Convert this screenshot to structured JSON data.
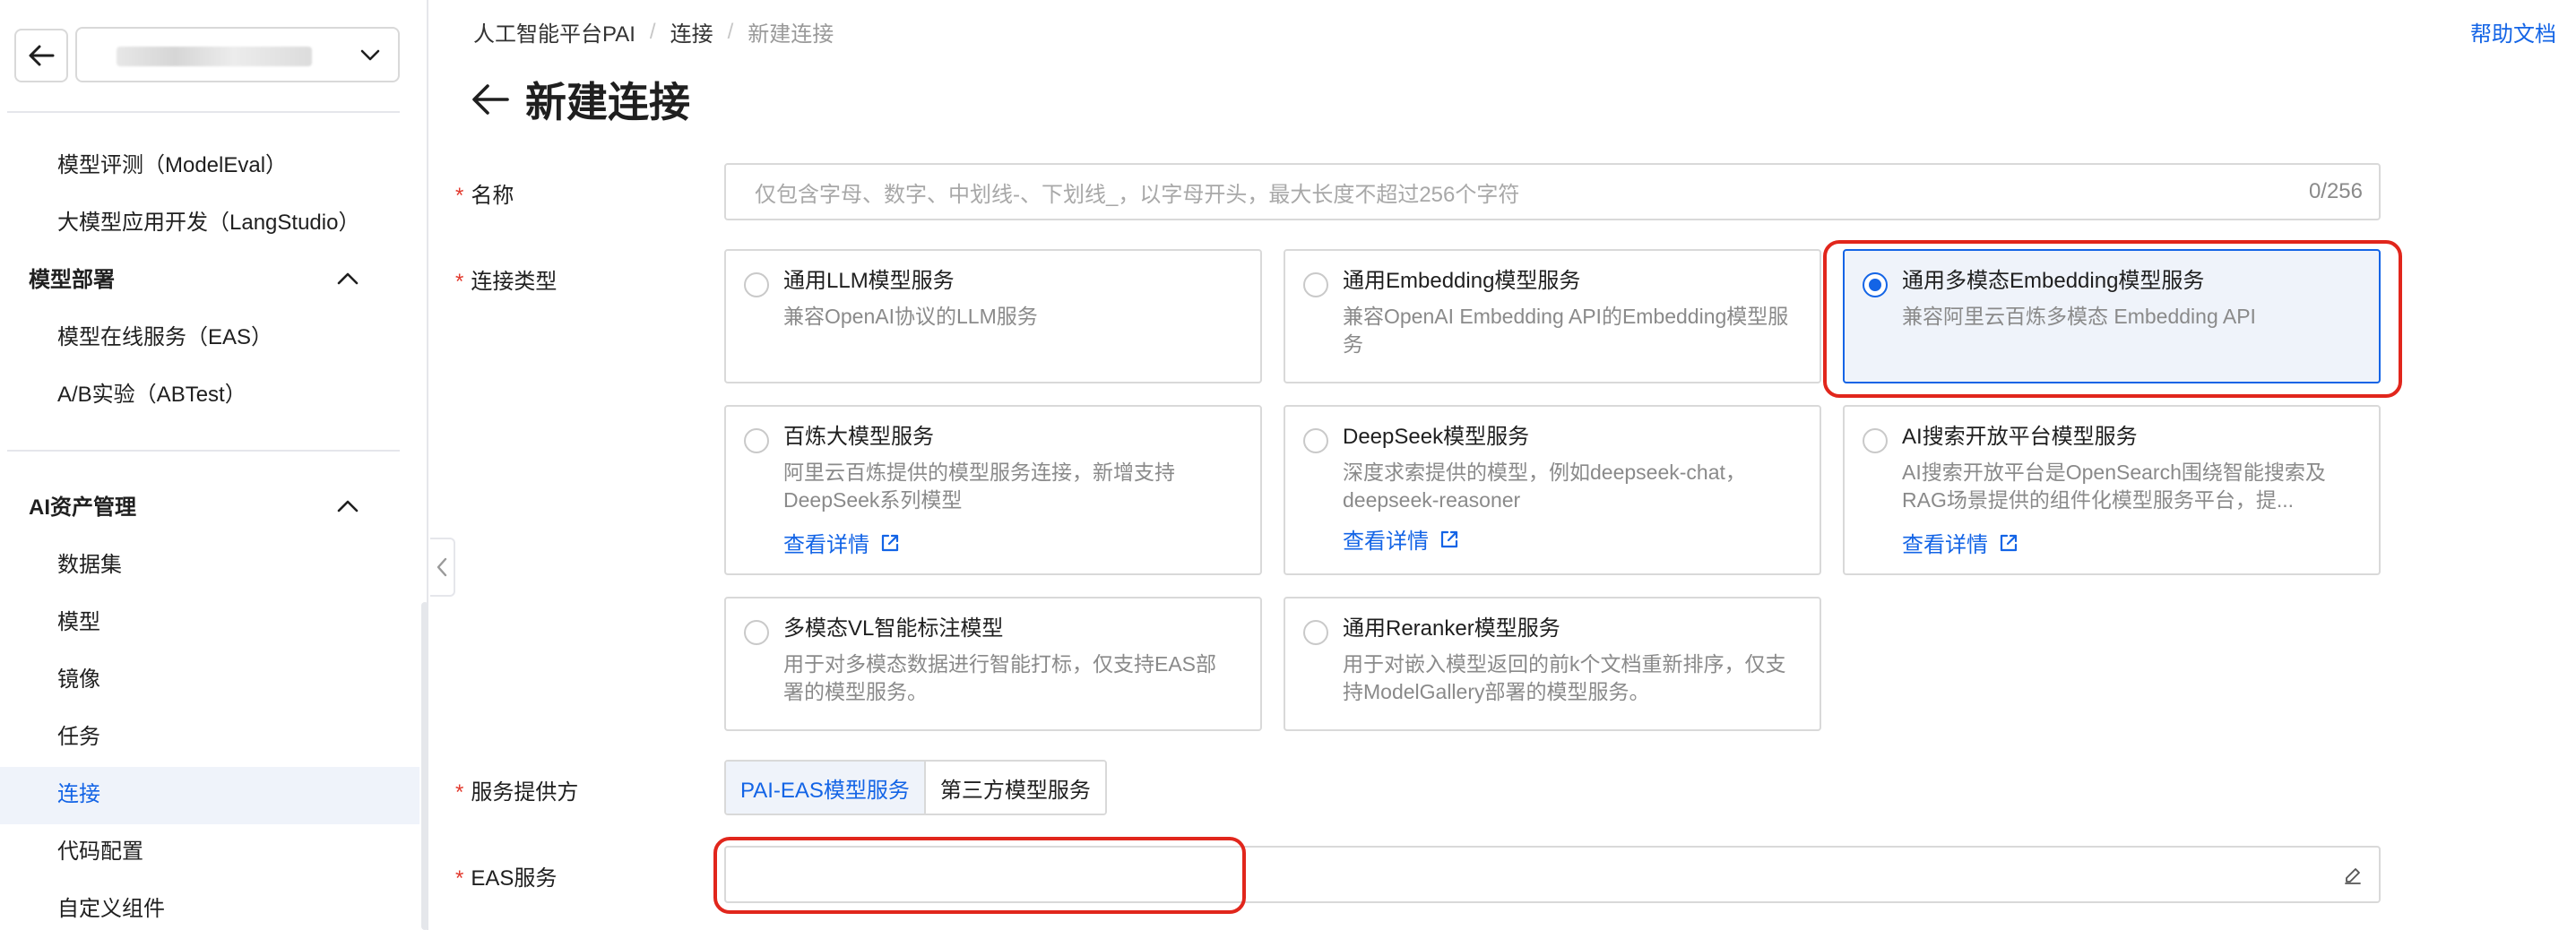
{
  "sidebar": {
    "workspace_value": "",
    "items_top": [
      {
        "label": "模型评测（ModelEval）"
      },
      {
        "label": "大模型应用开发（LangStudio）"
      }
    ],
    "group_deploy": {
      "label": "模型部署"
    },
    "items_deploy": [
      {
        "label": "模型在线服务（EAS）"
      },
      {
        "label": "A/B实验（ABTest）"
      }
    ],
    "group_assets": {
      "label": "AI资产管理"
    },
    "items_assets": [
      {
        "label": "数据集"
      },
      {
        "label": "模型"
      },
      {
        "label": "镜像"
      },
      {
        "label": "任务"
      },
      {
        "label": "连接",
        "active": true
      },
      {
        "label": "代码配置"
      },
      {
        "label": "自定义组件"
      }
    ]
  },
  "breadcrumb": [
    "人工智能平台PAI",
    "连接",
    "新建连接"
  ],
  "help_link": "帮助文档",
  "page_title": "新建连接",
  "form": {
    "name": {
      "label": "名称",
      "placeholder": "仅包含字母、数字、中划线-、下划线_，以字母开头，最大长度不超过256个字符",
      "count": "0/256"
    },
    "type": {
      "label": "连接类型",
      "selected": "通用多模态Embedding模型服务",
      "cards": [
        {
          "title": "通用LLM模型服务",
          "desc": "兼容OpenAI协议的LLM服务"
        },
        {
          "title": "通用Embedding模型服务",
          "desc": "兼容OpenAI Embedding API的Embedding模型服务"
        },
        {
          "title": "通用多模态Embedding模型服务",
          "desc": "兼容阿里云百炼多模态 Embedding API"
        },
        {
          "title": "百炼大模型服务",
          "desc": "阿里云百炼提供的模型服务连接，新增支持DeepSeek系列模型",
          "link": "查看详情"
        },
        {
          "title": "DeepSeek模型服务",
          "desc": "深度求索提供的模型，例如deepseek-chat，deepseek-reasoner",
          "link": "查看详情"
        },
        {
          "title": "AI搜索开放平台模型服务",
          "desc": "AI搜索开放平台是OpenSearch围绕智能搜索及RAG场景提供的组件化模型服务平台，提...",
          "link": "查看详情"
        },
        {
          "title": "多模态VL智能标注模型",
          "desc": "用于对多模态数据进行智能打标，仅支持EAS部署的模型服务。"
        },
        {
          "title": "通用Reranker模型服务",
          "desc": "用于对嵌入模型返回的前k个文档重新排序，仅支持ModelGallery部署的模型服务。"
        }
      ]
    },
    "provider": {
      "label": "服务提供方",
      "options": [
        "PAI-EAS模型服务",
        "第三方模型服务"
      ],
      "selected": "PAI-EAS模型服务"
    },
    "eas": {
      "label": "EAS服务",
      "value": ""
    }
  },
  "colors": {
    "accent": "#1364e6",
    "highlight": "#e1261c",
    "required": "#e23a2e",
    "selected_bg": "#eff3fa"
  },
  "icons": [
    "back-arrow-icon",
    "chevron-down-icon",
    "chevron-up-icon",
    "chevron-left-icon",
    "external-link-icon",
    "edit-icon"
  ]
}
